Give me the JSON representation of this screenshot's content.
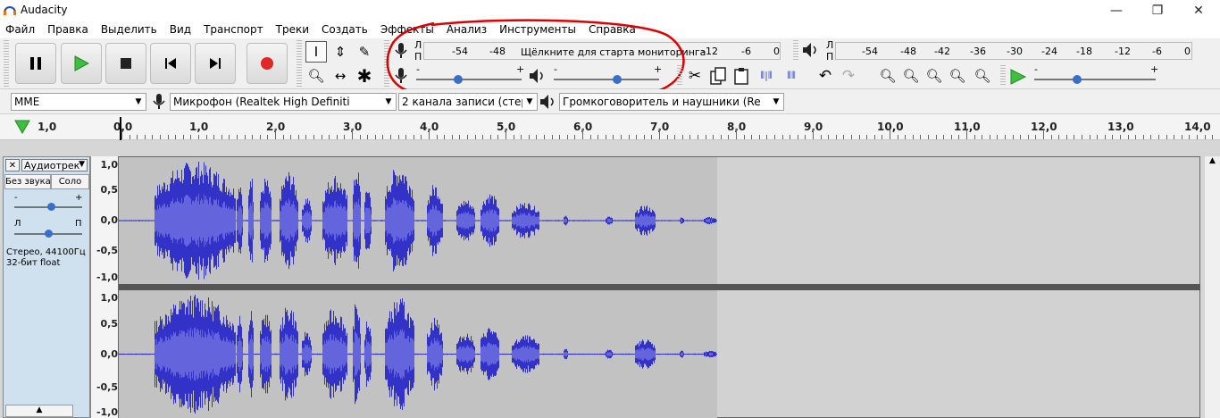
{
  "window": {
    "title": "Audacity",
    "minimize": "—",
    "maximize": "❐",
    "close": "✕"
  },
  "menu": [
    "Файл",
    "Правка",
    "Выделить",
    "Вид",
    "Транспорт",
    "Треки",
    "Создать",
    "Эффекты",
    "Анализ",
    "Инструменты",
    "Справка"
  ],
  "transport": {
    "pause": "pause",
    "play": "play",
    "stop": "stop",
    "skip_start": "skip-start",
    "skip_end": "skip-end",
    "record": "record"
  },
  "meters": {
    "rec_lr": [
      "Л",
      "П"
    ],
    "rec_scale": [
      "-54",
      "-48",
      "-12",
      "-6",
      "0"
    ],
    "rec_hint": "Щёлкните для старта мониторинга",
    "play_lr": [
      "Л",
      "П"
    ],
    "play_scale": [
      "-54",
      "-48",
      "-42",
      "-36",
      "-30",
      "-24",
      "-18",
      "-12",
      "-6",
      "0"
    ],
    "rec_volume": 0.4,
    "play_volume": 0.6,
    "playback_speed": 0.35,
    "slider_minus": "-",
    "slider_plus": "+"
  },
  "device": {
    "host": "MME",
    "mic": "Микрофон (Realtek High Definiti",
    "channels": "2 канала записи (стерес",
    "speaker": "Громкоговоритель и наушники (Re"
  },
  "ruler": {
    "labels": [
      "1,0",
      "0,0",
      "1,0",
      "2,0",
      "3,0",
      "4,0",
      "5,0",
      "6,0",
      "7,0",
      "8,0",
      "9,0",
      "10,0",
      "11,0",
      "12,0",
      "13,0",
      "14,0"
    ]
  },
  "track": {
    "name": "Аудиотрек",
    "mute": "Без звука",
    "solo": "Соло",
    "pan_left": "Л",
    "pan_right": "П",
    "gain_minus": "-",
    "gain_plus": "+",
    "info1": "Стерео, 44100Гц",
    "info2": "32-бит float",
    "gain": 0.55,
    "pan": 0.5,
    "collapse": "▲"
  },
  "scale": [
    "1,0",
    "0,5",
    "0,0",
    "-0,5",
    "-1,0"
  ],
  "colors": {
    "wave": "#3232c8",
    "wave_rms": "#6464dc",
    "clip_bg": "#c2c2c2",
    "annotation": "#e00000",
    "track_panel": "#cfe0ef"
  }
}
